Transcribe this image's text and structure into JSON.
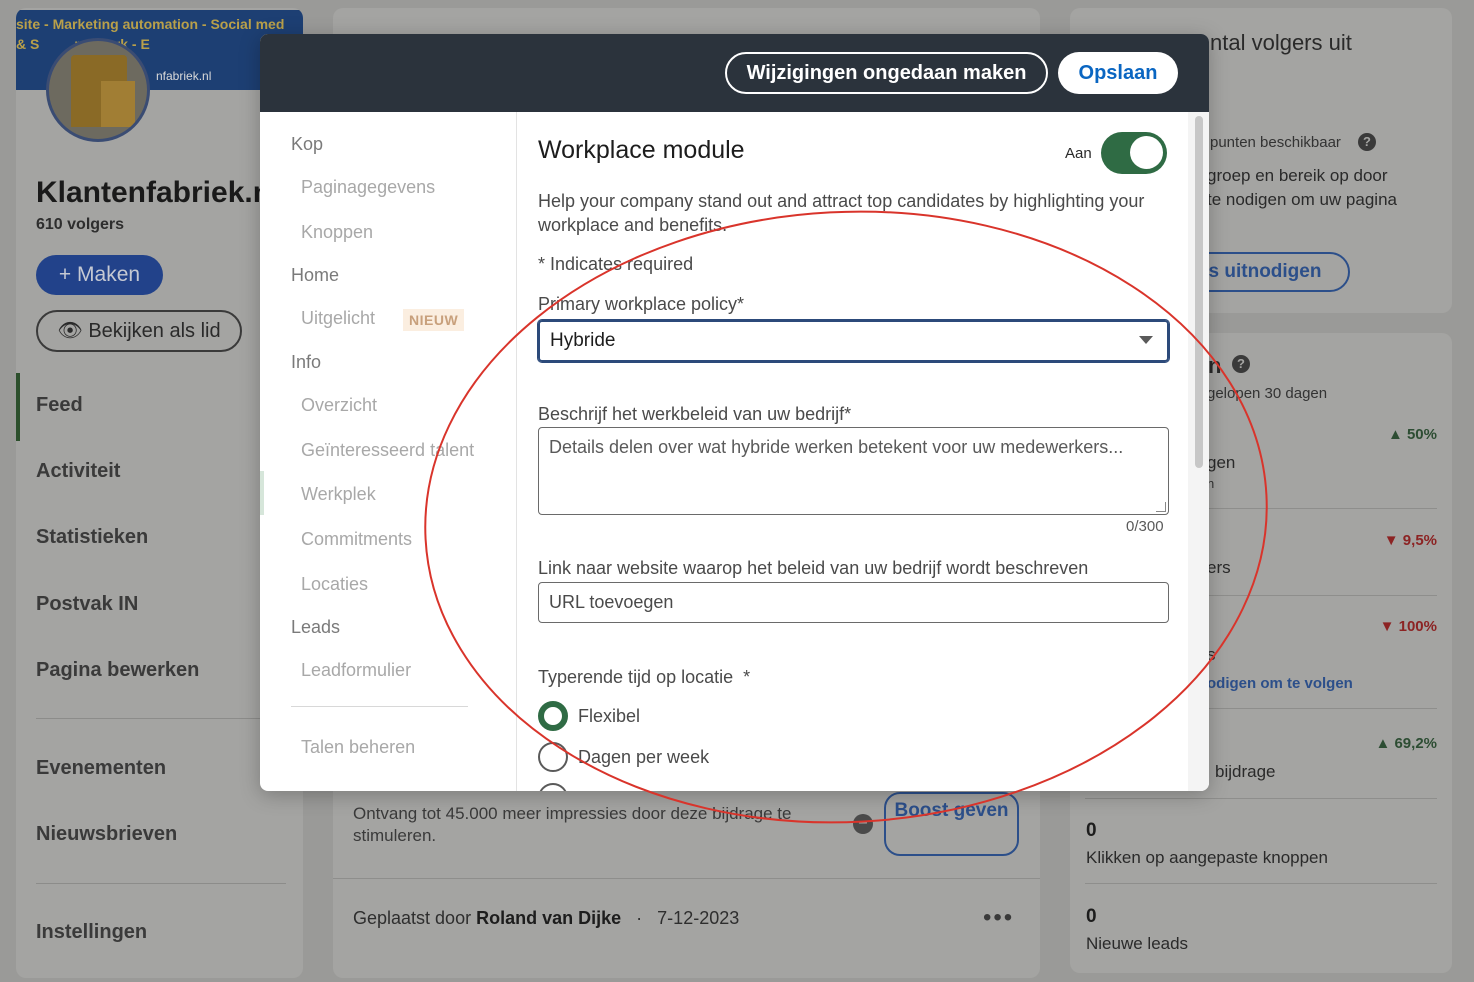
{
  "background": {
    "banner_line1": "site - Marketing automation - Social med",
    "banner_line2": "& S         rukwerk - E",
    "banner_domain": "nfabriek.nl",
    "company_name": "Klantenfabriek.n",
    "followers": "610 volgers",
    "make_button": "+ Maken",
    "view_as_member_button": "Bekijken als lid",
    "nav": [
      "Feed",
      "Activiteit",
      "Statistieken",
      "Postvak IN",
      "Pagina bewerken",
      "Evenementen",
      "Nieuwsbrieven",
      "Instellingen"
    ],
    "boost_text": "Ontvang tot 45.000 meer impressies door deze bijdrage te stimuleren.",
    "boost_button": "Boost geven",
    "posted_prefix": "Geplaatst door",
    "posted_author": "Roland van Dijke",
    "posted_separator": "·",
    "posted_date": "7-12-2023",
    "right_title": "ntal volgers uit",
    "right_credits": "punten beschikbaar",
    "right_desc1": "groep en bereik op door",
    "right_desc2": "te nodigen om uw pagina",
    "right_invite_button": "s uitnodigen",
    "stats_title": "n",
    "stats_period": "gelopen 30 dagen",
    "stats": [
      {
        "pct": "▲ 50%",
        "direction": "up",
        "label": "gen",
        "sub": "n"
      },
      {
        "pct": "▼ 9,5%",
        "direction": "down",
        "label": "ers"
      },
      {
        "pct": "▼ 100%",
        "direction": "down",
        "label": "s",
        "link": "odigen om te volgen"
      },
      {
        "pct": "▲ 69,2%",
        "direction": "up",
        "label": "bijdrage"
      }
    ],
    "clicks_value": "0",
    "clicks_label": "Klikken op aangepaste knoppen",
    "leads_value": "0",
    "leads_label": "Nieuwe leads"
  },
  "modal": {
    "undo_button": "Wijzigingen ongedaan maken",
    "save_button": "Opslaan",
    "sidebar": {
      "sections": [
        {
          "label": "Kop",
          "items": [
            "Paginagegevens",
            "Knoppen"
          ]
        },
        {
          "label": "Home",
          "items": [
            "Uitgelicht"
          ]
        },
        {
          "label": "Info",
          "items": [
            "Overzicht",
            "Geïnteresseerd talent",
            "Werkplek",
            "Commitments",
            "Locaties"
          ]
        },
        {
          "label": "Leads",
          "items": [
            "Leadformulier"
          ]
        }
      ],
      "new_badge": "NIEUW",
      "manage_languages": "Talen beheren",
      "active_item": "Werkplek"
    },
    "content": {
      "title": "Workplace module",
      "toggle_label": "Aan",
      "toggle_on": true,
      "description": "Help your company stand out and attract top candidates by highlighting your workplace and benefits.",
      "required_note": "* Indicates required",
      "policy_label": "Primary workplace policy*",
      "policy_value": "Hybride",
      "describe_label": "Beschrijf het werkbeleid van uw bedrijf*",
      "describe_placeholder": "Details delen over wat hybride werken betekent voor uw medewerkers...",
      "describe_counter": "0/300",
      "link_label": "Link naar website waarop het beleid van uw bedrijf wordt beschreven",
      "link_placeholder": "URL toevoegen",
      "time_label": "Typerende tijd op locatie  *",
      "time_options": [
        "Flexibel",
        "Dagen per week"
      ],
      "time_selected": "Flexibel"
    }
  },
  "colors": {
    "header_bg": "#2b333c",
    "save_blue": "#0a66c2",
    "toggle_green": "#2f6b44",
    "annotation_red": "#d9342b"
  }
}
